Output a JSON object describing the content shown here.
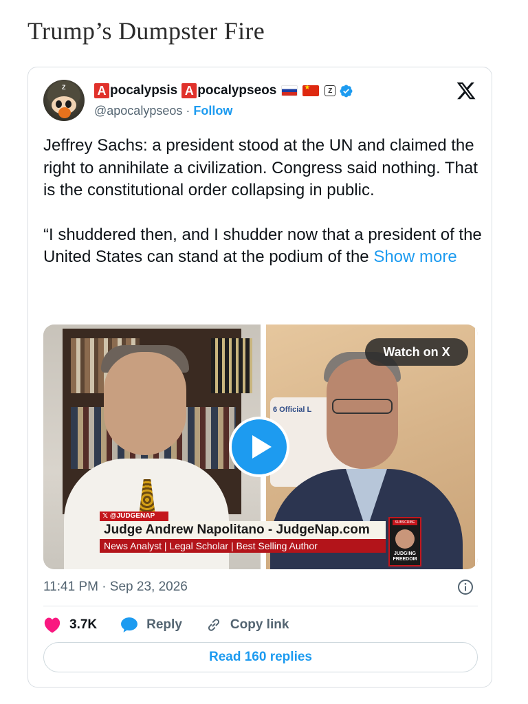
{
  "page": {
    "title": "Trump’s Dumpster Fire"
  },
  "tweet": {
    "author": {
      "display_name_part1": "pocalypsis",
      "display_name_part2": "pocalypseos",
      "emoji_letter": "A",
      "handle": "@apocalypseos",
      "separator": " · ",
      "follow_label": "Follow",
      "avatar_icon": "military-helmet-cartoon-avatar",
      "badges": [
        "flag-russia",
        "flag-china",
        "z-badge",
        "verified-badge"
      ]
    },
    "body": {
      "paragraph1": "Jeffrey Sachs: a president stood at the UN and claimed the right to annihilate a civilization. Congress said nothing. That is the constitutional order collapsing in public.",
      "paragraph2": "“I shuddered then, and I shudder now that a president of the United States can stand at the podium of the ",
      "show_more": "Show more"
    },
    "media": {
      "watch_label": "Watch on X",
      "lower_third_handle": "𝕏 @JUDGENAP",
      "lower_third_name": "Judge Andrew Napolitano  - JudgeNap.com",
      "lower_third_subtitle": "News Analyst | Legal Scholar | Best Selling Author",
      "sign_text": "6 Official L",
      "logo_subscribe": "SUBSCRIBE",
      "logo_text": "JUDGING FREEDOM"
    },
    "timestamp": "11:41 PM · Sep 23, 2026",
    "actions": {
      "likes": "3.7K",
      "reply_label": "Reply",
      "copy_label": "Copy link"
    },
    "read_replies": "Read 160 replies"
  },
  "colors": {
    "accent": "#1d9bf0",
    "like": "#f91880",
    "muted": "#536471",
    "text": "#0f1419"
  }
}
